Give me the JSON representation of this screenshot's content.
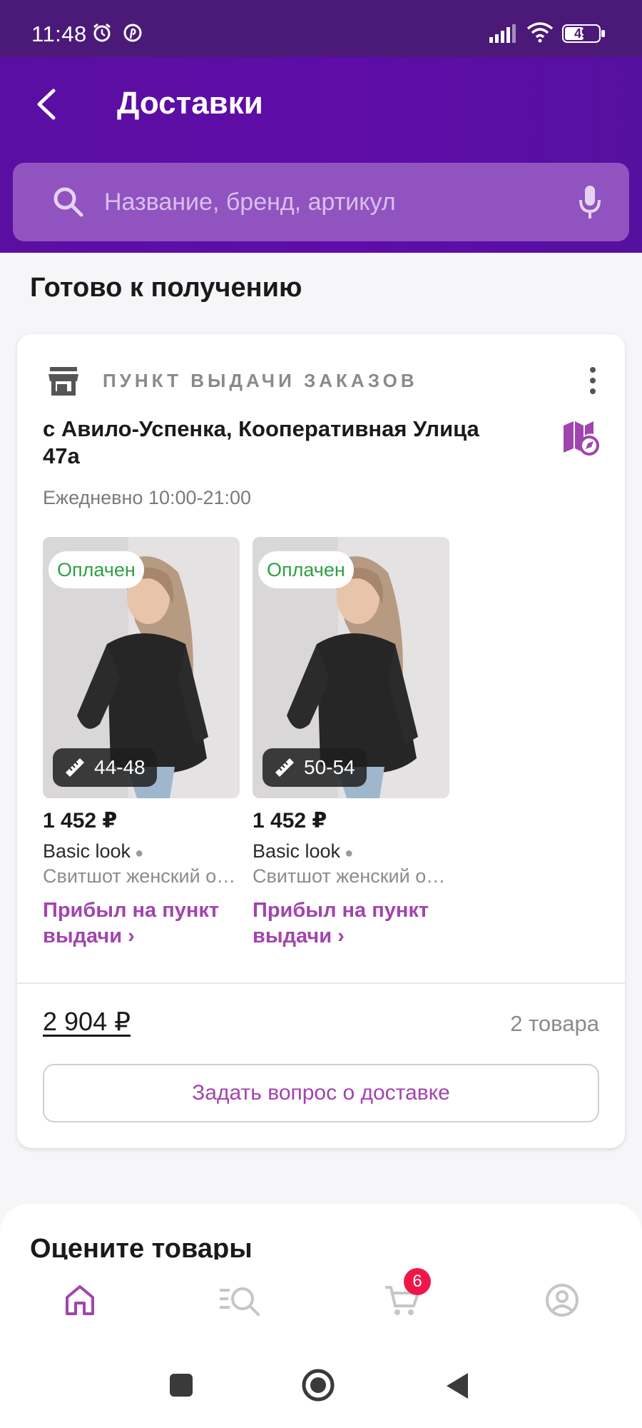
{
  "status_bar": {
    "time": "11:48",
    "battery": "49",
    "icons": [
      "alarm-icon",
      "pinterest-icon",
      "signal-icon",
      "wifi-icon",
      "battery-icon"
    ]
  },
  "header": {
    "title": "Доставки",
    "search_placeholder": "Название, бренд, артикул"
  },
  "section_title": "Готово к получению",
  "pickup": {
    "label": "ПУНКТ ВЫДАЧИ ЗАКАЗОВ",
    "address": "с Авило-Успенка, Кооперативная Улица 47а",
    "hours": "Ежедневно 10:00-21:00"
  },
  "products": [
    {
      "badge": "Оплачен",
      "size": "44-48",
      "price": "1 452 ₽",
      "brand": "Basic look",
      "description": "Свитшот женский оверсайз",
      "status": "Прибыл на пункт выдачи ›"
    },
    {
      "badge": "Оплачен",
      "size": "50-54",
      "price": "1 452 ₽",
      "brand": "Basic look",
      "description": "Свитшот женский оверсайз",
      "status": "Прибыл на пункт выдачи ›"
    }
  ],
  "summary": {
    "total": "2 904 ₽",
    "items_count": "2 товара",
    "ask_button": "Задать вопрос о доставке"
  },
  "rate_section_title": "Оцените товары",
  "bottom_nav": {
    "cart_badge": "6",
    "items": [
      "home-icon",
      "catalog-search-icon",
      "cart-icon",
      "profile-icon"
    ],
    "active_color": "#a244ae"
  },
  "colors": {
    "header": "#5a0fa2",
    "accent": "#a244ae",
    "paid": "#2ea043",
    "badge": "#f0164a"
  }
}
